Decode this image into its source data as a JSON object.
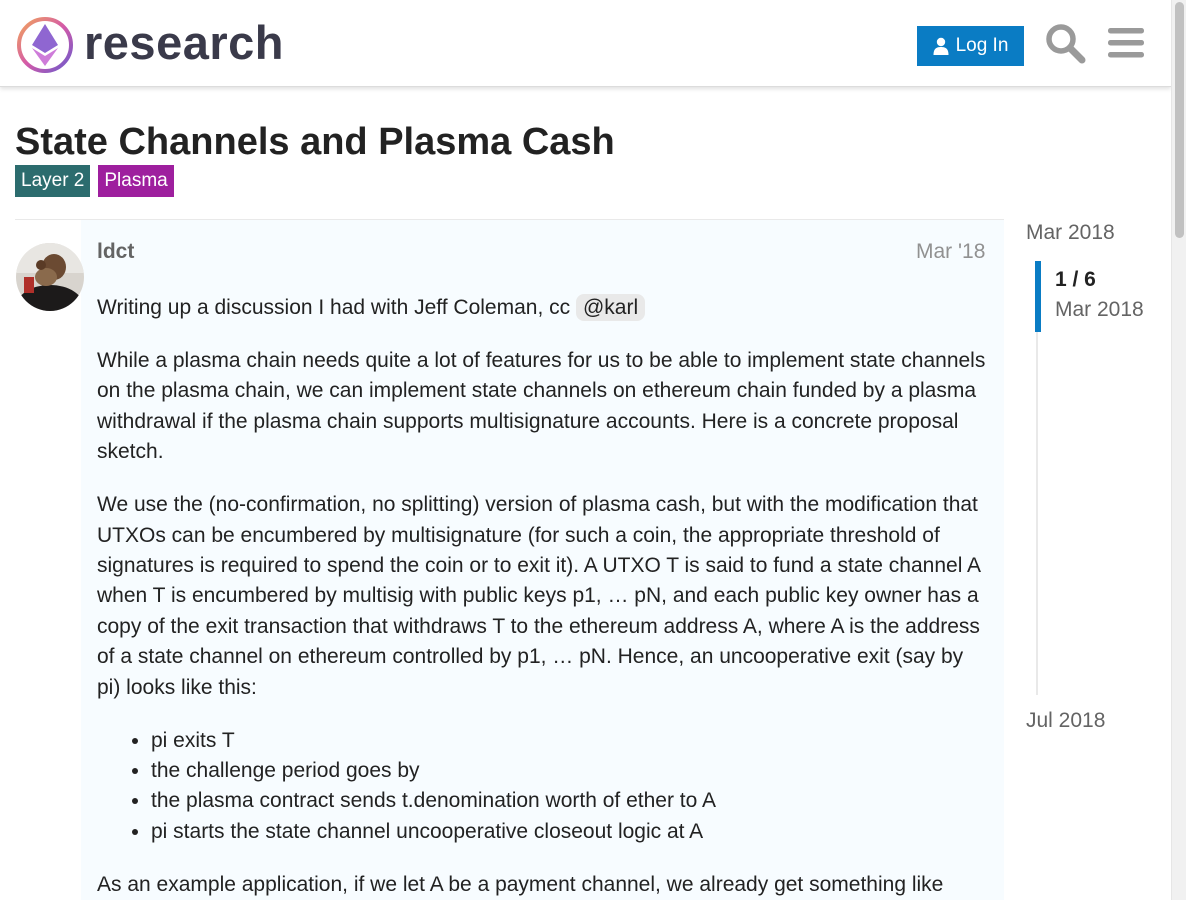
{
  "header": {
    "logo_text": "research",
    "login_label": "Log In",
    "icons": [
      "logo-icon",
      "user-icon",
      "search-icon",
      "hamburger-menu-icon"
    ]
  },
  "topic": {
    "title": "State Channels and Plasma Cash",
    "tags": [
      {
        "label": "Layer 2",
        "color": "#2c6c6e"
      },
      {
        "label": "Plasma",
        "color": "#9e1f9e"
      }
    ]
  },
  "post": {
    "username": "ldct",
    "date": "Mar '18",
    "intro": "Writing up a discussion I had with Jeff Coleman, cc ",
    "mention": "@karl",
    "paragraph_1": "While a plasma chain needs quite a lot of features for us to be able to implement state channels on the plasma chain, we can implement state channels on ethereum chain funded by a plasma withdrawal if the plasma chain supports multisignature accounts. Here is a concrete proposal sketch.",
    "paragraph_2": "We use the (no-confirmation, no splitting) version of plasma cash, but with the modification that UTXOs can be encumbered by multisignature (for such a coin, the appropriate threshold of signatures is required to spend the coin or to exit it). A UTXO T is said to fund a state channel A when T is encumbered by multisig with public keys p1, … pN, and each public key owner has a copy of the exit transaction that withdraws T to the ethereum address A, where A is the address of a state channel on ethereum controlled by p1, … pN. Hence, an uncooperative exit (say by pi) looks like this:",
    "list_items": [
      "pi exits T",
      "the challenge period goes by",
      "the plasma contract sends t.denomination worth of ether to A",
      "pi starts the state channel uncooperative closeout logic at A"
    ],
    "paragraph_3": "As an example application, if we let A be a payment channel, we already get something like"
  },
  "timeline": {
    "start_date": "Mar 2018",
    "position": "1 / 6",
    "current_date": "Mar 2018",
    "end_date": "Jul 2018"
  },
  "colors": {
    "accent": "#0a7cc4",
    "post_background": "#f7fcff"
  }
}
